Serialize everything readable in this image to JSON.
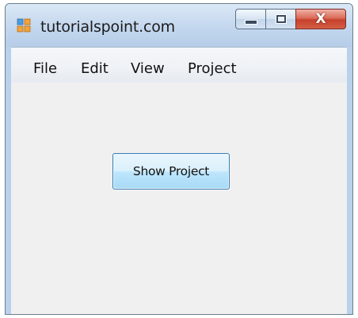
{
  "window": {
    "title": "tutorialspoint.com",
    "caption_buttons": {
      "minimize": "minimize-icon",
      "maximize": "maximize-icon",
      "close": "close-icon"
    },
    "close_glyph": "X"
  },
  "menubar": {
    "items": [
      {
        "label": "File"
      },
      {
        "label": "Edit"
      },
      {
        "label": "View"
      },
      {
        "label": "Project"
      }
    ]
  },
  "main": {
    "show_project_label": "Show Project"
  },
  "colors": {
    "close_button": "#c7402c",
    "button_accent": "#3c7fb1",
    "client_background": "#f0f0f0"
  }
}
